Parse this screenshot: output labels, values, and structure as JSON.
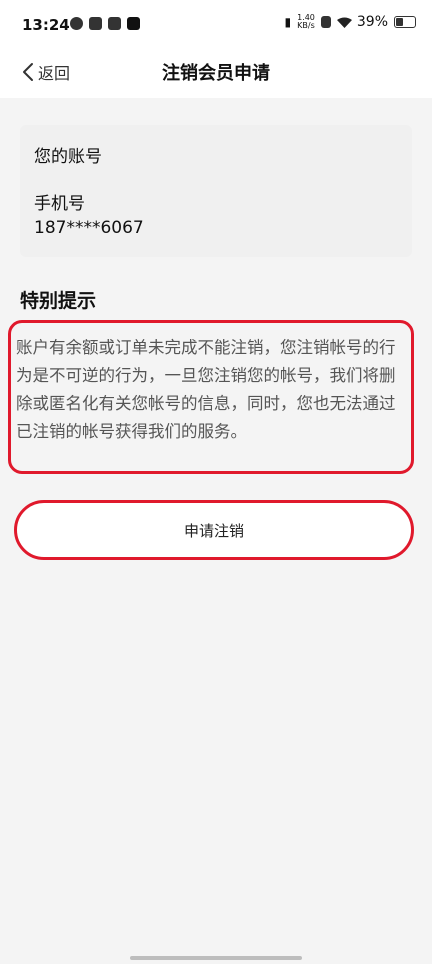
{
  "status_bar": {
    "time": "13:24",
    "net_speed_value": "1.40",
    "net_speed_unit": "KB/s",
    "battery": "39%"
  },
  "header": {
    "back_label": "返回",
    "title": "注销会员申请"
  },
  "account": {
    "heading": "您的账号",
    "phone_label": "手机号",
    "phone_value": "187****6067"
  },
  "notice": {
    "title": "特别提示",
    "text": "账户有余额或订单未完成不能注销，您注销帐号的行为是不可逆的行为，一旦您注销您的帐号，我们将删除或匿名化有关您帐号的信息，同时，您也无法通过已注销的帐号获得我们的服务。"
  },
  "actions": {
    "submit_label": "申请注销"
  },
  "colors": {
    "highlight": "#e0192c",
    "background": "#f4f4f4"
  }
}
